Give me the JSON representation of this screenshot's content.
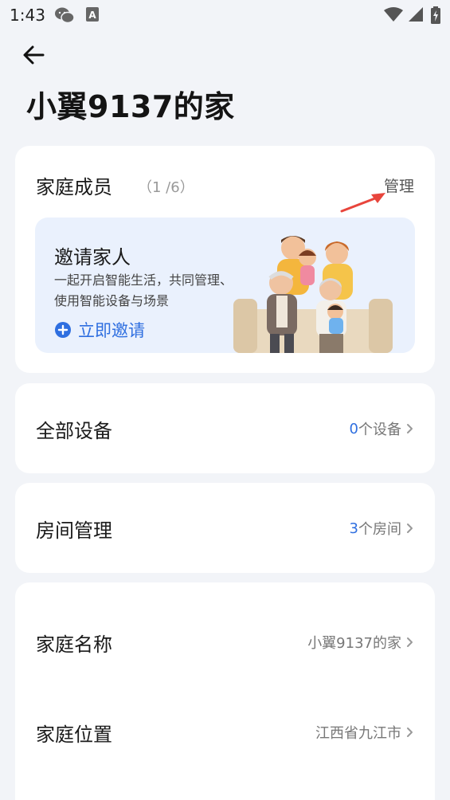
{
  "status": {
    "time": "1:43",
    "icons": [
      "wechat-icon",
      "font-icon",
      "wifi-icon",
      "signal-icon",
      "battery-icon"
    ]
  },
  "header": {
    "back_icon": "arrow-left-icon",
    "title": "小翼9137的家"
  },
  "members": {
    "title": "家庭成员",
    "count": "（1 /6）",
    "manage_label": "管理",
    "invite": {
      "title": "邀请家人",
      "desc_line1": "一起开启智能生活，共同管理、",
      "desc_line2": "使用智能设备与场景",
      "button_label": "立即邀请"
    }
  },
  "devices": {
    "label": "全部设备",
    "count": "0",
    "unit": "个设备"
  },
  "rooms": {
    "label": "房间管理",
    "count": "3",
    "unit": "个房间"
  },
  "home_info": {
    "name_label": "家庭名称",
    "name_value": "小翼9137的家",
    "location_label": "家庭位置",
    "location_value": "江西省九江市"
  },
  "colors": {
    "accent": "#2f6fe0",
    "annotation": "#e8453c",
    "background": "#f2f4f8"
  }
}
